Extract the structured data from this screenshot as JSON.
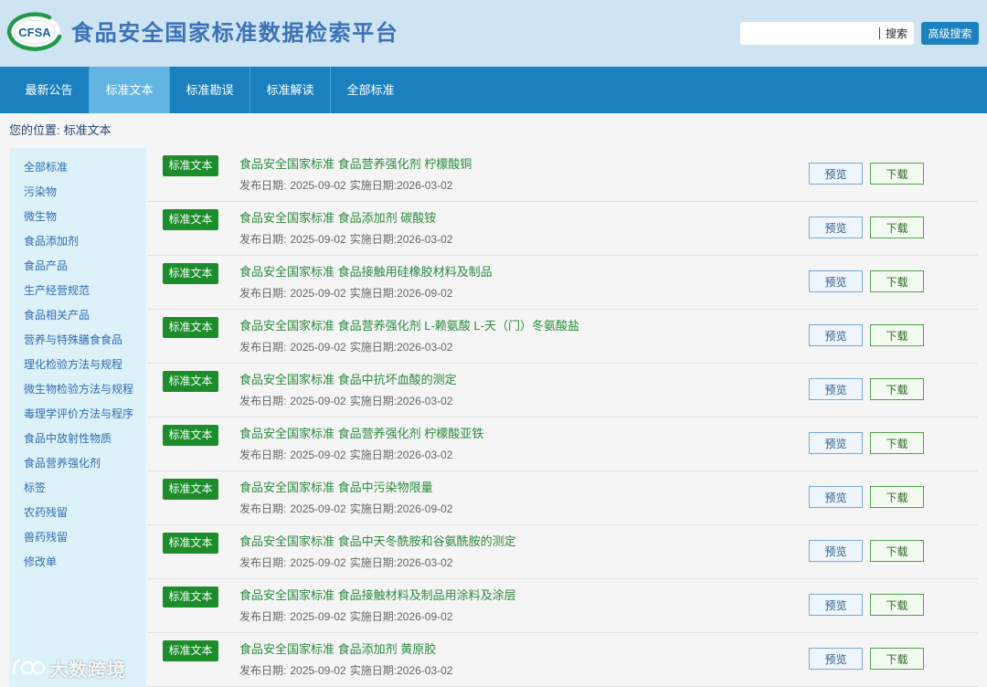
{
  "colors": {
    "header_bg": "#cfe4f2",
    "title_blue": "#3b72b8",
    "nav_bg": "#1b81be",
    "nav_active_bg": "#62b5e3",
    "sidebar_bg": "#ddf1f9",
    "badge_green": "#1d8d2c",
    "link_green": "#2b8a3e",
    "sidebar_link": "#2f6db3"
  },
  "header": {
    "logo_text": "CFSA",
    "title": "食品安全国家标准数据检索平台",
    "search": {
      "value": "",
      "button_label": "搜索"
    },
    "advanced_search_label": "高级搜索"
  },
  "nav": {
    "items": [
      {
        "label": "最新公告",
        "active": false
      },
      {
        "label": "标准文本",
        "active": true
      },
      {
        "label": "标准勘误",
        "active": false
      },
      {
        "label": "标准解读",
        "active": false
      },
      {
        "label": "全部标准",
        "active": false
      }
    ]
  },
  "breadcrumb": {
    "prefix": "您的位置:",
    "current": "标准文本"
  },
  "sidebar": {
    "items": [
      "全部标准",
      "污染物",
      "微生物",
      "食品添加剂",
      "食品产品",
      "生产经营规范",
      "食品相关产品",
      "营养与特殊膳食食品",
      "理化检验方法与规程",
      "微生物检验方法与规程",
      "毒理学评价方法与程序",
      "食品中放射性物质",
      "食品营养强化剂",
      "标签",
      "农药残留",
      "兽药残留",
      "修改单"
    ]
  },
  "list": {
    "badge_label": "标准文本",
    "publish_label": "发布日期:",
    "effective_label": "实施日期:",
    "preview_label": "预览",
    "download_label": "下载",
    "rows": [
      {
        "title": "食品安全国家标准 食品营养强化剂 柠檬酸铜",
        "publish_date": "2025-09-02",
        "effective_date": "2026-03-02"
      },
      {
        "title": "食品安全国家标准 食品添加剂 碳酸铵",
        "publish_date": "2025-09-02",
        "effective_date": "2026-03-02"
      },
      {
        "title": "食品安全国家标准 食品接触用硅橡胶材料及制品",
        "publish_date": "2025-09-02",
        "effective_date": "2026-09-02"
      },
      {
        "title": "食品安全国家标准 食品营养强化剂 L-赖氨酸 L-天（门）冬氨酸盐",
        "publish_date": "2025-09-02",
        "effective_date": "2026-03-02"
      },
      {
        "title": "食品安全国家标准 食品中抗坏血酸的测定",
        "publish_date": "2025-09-02",
        "effective_date": "2026-03-02"
      },
      {
        "title": "食品安全国家标准 食品营养强化剂 柠檬酸亚铁",
        "publish_date": "2025-09-02",
        "effective_date": "2026-03-02"
      },
      {
        "title": "食品安全国家标准 食品中污染物限量",
        "publish_date": "2025-09-02",
        "effective_date": "2026-09-02"
      },
      {
        "title": "食品安全国家标准 食品中天冬酰胺和谷氨酰胺的测定",
        "publish_date": "2025-09-02",
        "effective_date": "2026-03-02"
      },
      {
        "title": "食品安全国家标准 食品接触材料及制品用涂料及涂层",
        "publish_date": "2025-09-02",
        "effective_date": "2026-09-02"
      },
      {
        "title": "食品安全国家标准 食品添加剂 黄原胶",
        "publish_date": "2025-09-02",
        "effective_date": "2026-03-02"
      }
    ]
  },
  "watermark": {
    "text": "大数跨境"
  }
}
